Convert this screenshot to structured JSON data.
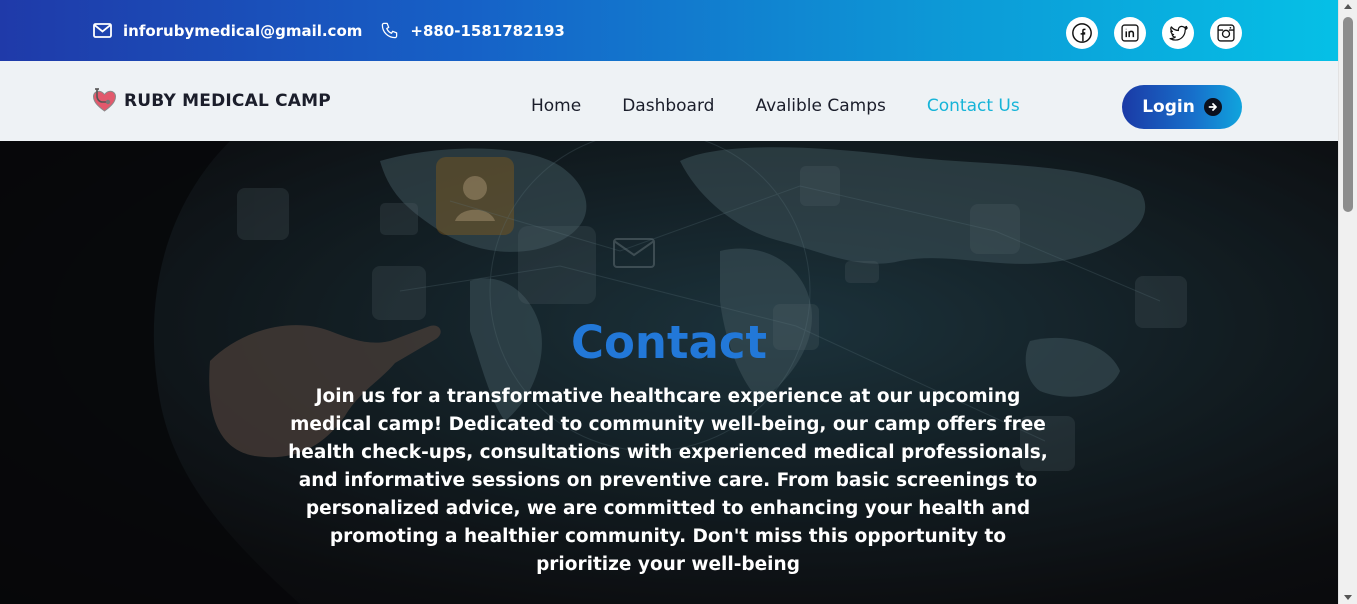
{
  "topbar": {
    "email": "inforubymedical@gmail.com",
    "phone": "+880-1581782193",
    "socials": [
      {
        "name": "facebook",
        "icon": "facebook-icon"
      },
      {
        "name": "linkedin",
        "icon": "linkedin-icon"
      },
      {
        "name": "twitter",
        "icon": "twitter-icon"
      },
      {
        "name": "instagram",
        "icon": "instagram-icon"
      }
    ]
  },
  "navbar": {
    "brand": "RUBY MEDICAL CAMP",
    "menu": [
      "Home",
      "Dashboard",
      "Avalible Camps",
      "Contact Us"
    ],
    "active": "Contact Us",
    "login_label": "Login"
  },
  "hero": {
    "title": "Contact",
    "text": "Join us for a transformative healthcare experience at our upcoming medical camp! Dedicated to community well-being, our camp offers free health check-ups, consultations with experienced medical professionals, and informative sessions on preventive care. From basic screenings to personalized advice, we are committed to enhancing your health and promoting a healthier community. Don't miss this opportunity to prioritize your well-being"
  },
  "colors": {
    "active_link": "#16b4d8",
    "title_blue": "#2278d8",
    "topbar_start": "#1f3aa9",
    "topbar_end": "#05c0e6"
  }
}
